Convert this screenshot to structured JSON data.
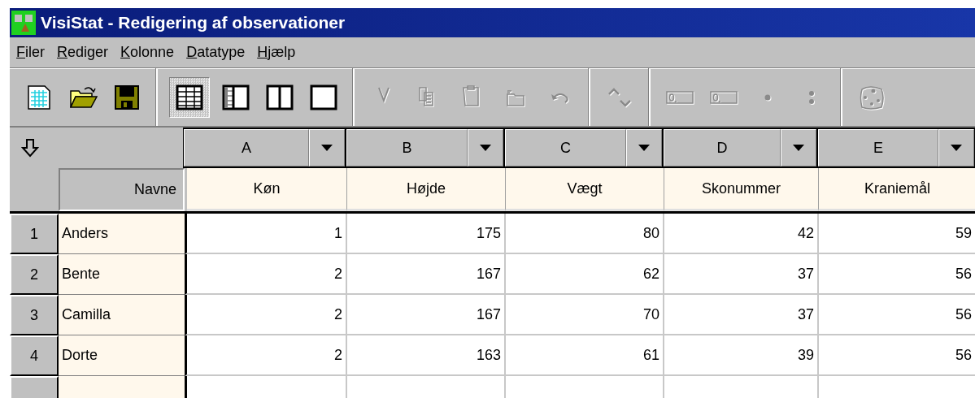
{
  "window": {
    "title": "VisiStat - Redigering af observationer"
  },
  "menu": [
    {
      "label": "Filer"
    },
    {
      "label": "Rediger"
    },
    {
      "label": "Kolonne"
    },
    {
      "label": "Datatype"
    },
    {
      "label": "Hjælp"
    }
  ],
  "toolbar": [
    {
      "buttons": [
        {
          "kind": "new",
          "disabled": false
        },
        {
          "kind": "open",
          "disabled": false
        },
        {
          "kind": "save",
          "disabled": false
        }
      ]
    },
    {
      "buttons": [
        {
          "kind": "table",
          "disabled": false,
          "selected": true
        },
        {
          "kind": "names",
          "disabled": false,
          "selected": false
        },
        {
          "kind": "split",
          "disabled": false,
          "selected": false
        },
        {
          "kind": "blank",
          "disabled": false,
          "selected": false
        }
      ]
    },
    {
      "buttons": [
        {
          "kind": "cut",
          "disabled": true
        },
        {
          "kind": "copy",
          "disabled": true
        },
        {
          "kind": "paste",
          "disabled": true
        },
        {
          "kind": "folder",
          "disabled": true
        },
        {
          "kind": "undo",
          "disabled": true
        }
      ]
    },
    {
      "buttons": [
        {
          "kind": "sort",
          "disabled": true
        }
      ]
    },
    {
      "buttons": [
        {
          "kind": "decimal",
          "disabled": true
        },
        {
          "kind": "decimal",
          "disabled": true
        },
        {
          "kind": "dot",
          "disabled": true
        },
        {
          "kind": "colon",
          "disabled": true
        }
      ]
    },
    {
      "buttons": [
        {
          "kind": "palette",
          "disabled": true
        }
      ]
    }
  ],
  "grid": {
    "name_header": "Navne",
    "columns": [
      {
        "letter": "A",
        "name": "Køn"
      },
      {
        "letter": "B",
        "name": "Højde"
      },
      {
        "letter": "C",
        "name": "Vægt"
      },
      {
        "letter": "D",
        "name": "Skonummer"
      },
      {
        "letter": "E",
        "name": "Kraniemål"
      }
    ],
    "rows": [
      {
        "number": "1",
        "name": "Anders",
        "values": [
          "1",
          "175",
          "80",
          "42",
          "59"
        ]
      },
      {
        "number": "2",
        "name": "Bente",
        "values": [
          "2",
          "167",
          "62",
          "37",
          "56"
        ]
      },
      {
        "number": "3",
        "name": "Camilla",
        "values": [
          "2",
          "167",
          "70",
          "37",
          "56"
        ]
      },
      {
        "number": "4",
        "name": "Dorte",
        "values": [
          "2",
          "163",
          "61",
          "39",
          "56"
        ]
      }
    ]
  }
}
